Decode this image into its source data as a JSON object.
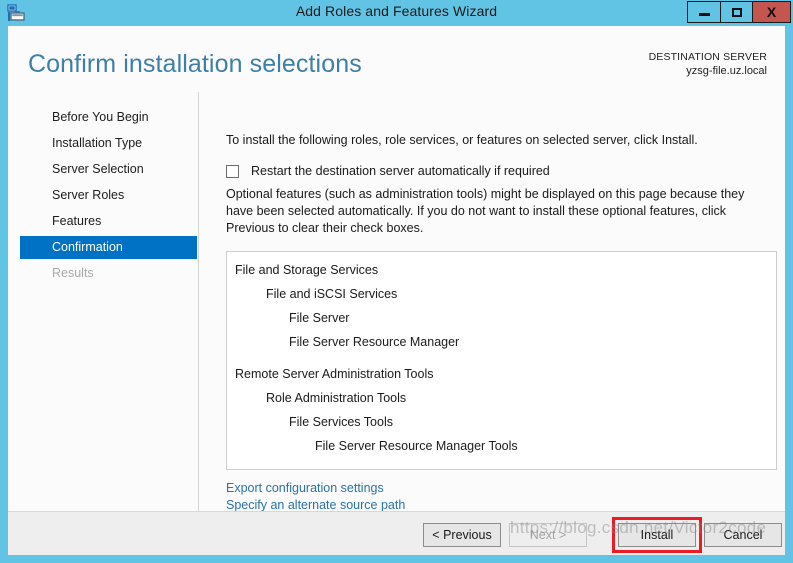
{
  "window": {
    "title": "Add Roles and Features Wizard",
    "icon": "wizard-server-icon",
    "controls": {
      "minimize": "minimize-icon",
      "maximize": "maximize-icon",
      "close": "X"
    },
    "frame_color": "#62c4e4",
    "close_color": "#c4564f"
  },
  "header": {
    "title": "Confirm installation selections",
    "destination_label": "DESTINATION SERVER",
    "destination_value": "yzsg-file.uz.local",
    "title_color": "#3d7fa6"
  },
  "sidebar": {
    "selected_color": "#0072c6",
    "items": [
      {
        "label": "Before You Begin",
        "state": "normal"
      },
      {
        "label": "Installation Type",
        "state": "normal"
      },
      {
        "label": "Server Selection",
        "state": "normal"
      },
      {
        "label": "Server Roles",
        "state": "normal"
      },
      {
        "label": "Features",
        "state": "normal"
      },
      {
        "label": "Confirmation",
        "state": "selected"
      },
      {
        "label": "Results",
        "state": "disabled"
      }
    ]
  },
  "content": {
    "intro_text": "To install the following roles, role services, or features on selected server, click Install.",
    "restart_checkbox_label": "Restart the destination server automatically if required",
    "restart_checkbox_checked": false,
    "optional_text": "Optional features (such as administration tools) might be displayed on this page because they have been selected automatically. If you do not want to install these optional features, click Previous to clear their check boxes.",
    "selections": [
      {
        "label": "File and Storage Services",
        "level": 0
      },
      {
        "label": "File and iSCSI Services",
        "level": 1
      },
      {
        "label": "File Server",
        "level": 2
      },
      {
        "label": "File Server Resource Manager",
        "level": 2
      },
      {
        "label": "",
        "level": -1
      },
      {
        "label": "Remote Server Administration Tools",
        "level": 0
      },
      {
        "label": "Role Administration Tools",
        "level": 1
      },
      {
        "label": "File Services Tools",
        "level": 2
      },
      {
        "label": "File Server Resource Manager Tools",
        "level": 3
      }
    ],
    "links": [
      {
        "label": "Export configuration settings"
      },
      {
        "label": "Specify an alternate source path"
      }
    ],
    "link_color": "#2a72a8"
  },
  "footer": {
    "buttons": [
      {
        "label": "< Previous",
        "state": "enabled"
      },
      {
        "label": "Next >",
        "state": "disabled"
      },
      {
        "label": "Install",
        "state": "enabled",
        "highlighted": true
      },
      {
        "label": "Cancel",
        "state": "enabled"
      }
    ],
    "highlight_color": "#ec1c24"
  },
  "watermark": {
    "text": "https://blog.csdn.net/Victor2code"
  }
}
